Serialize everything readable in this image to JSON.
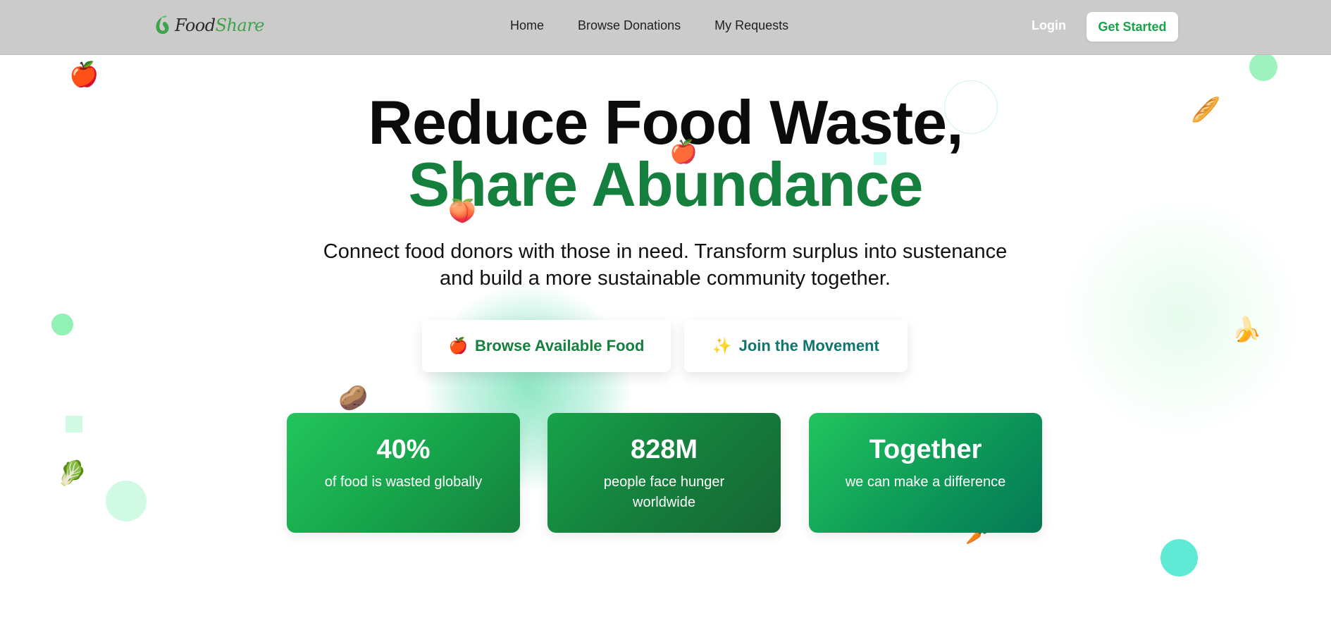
{
  "nav": {
    "logo_food": "Food",
    "logo_share": "Share",
    "links": [
      "Home",
      "Browse Donations",
      "My Requests"
    ],
    "login": "Login",
    "cta": "Get Started"
  },
  "hero": {
    "title_line1": "Reduce Food Waste,",
    "title_line2": "Share Abundance",
    "subtitle": "Connect food donors with those in need. Transform surplus into sustenance and build a more sustainable community together.",
    "buttons": [
      {
        "icon": "🍎",
        "label": "Browse Available Food"
      },
      {
        "icon": "✨",
        "label": "Join the Movement"
      }
    ]
  },
  "stats": [
    {
      "value": "40%",
      "label": "of food is wasted globally"
    },
    {
      "value": "828M",
      "label": "people face hunger worldwide"
    },
    {
      "value": "Together",
      "label": "we can make a difference"
    }
  ],
  "decorations": {
    "apple": "🍎",
    "bread": "🥖",
    "banana": "🍌",
    "potato": "🥔",
    "lettuce": "🥬",
    "carrot": "🥕",
    "peach": "🍑"
  },
  "colors": {
    "nav_bg": "#cbcbcb",
    "primary_green": "#15803d",
    "accent_green": "#16a34a",
    "teal": "#0f766e"
  }
}
